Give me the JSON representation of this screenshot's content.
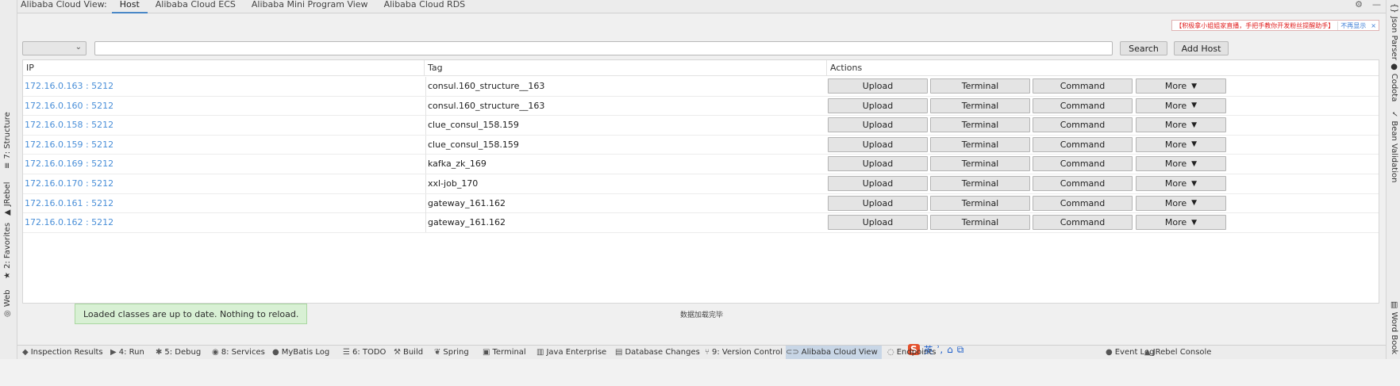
{
  "top_bar": {
    "tool_title": "Alibaba Cloud View:",
    "tabs": [
      {
        "label": "Host",
        "active": true
      },
      {
        "label": "Alibaba Cloud ECS",
        "active": false
      },
      {
        "label": "Alibaba Mini Program View",
        "active": false
      },
      {
        "label": "Alibaba Cloud RDS",
        "active": false
      }
    ],
    "gear_glyph": "⚙",
    "hide_glyph": "—"
  },
  "left_side_tabs": [
    {
      "label": "7: Structure",
      "glyph": "≡"
    },
    {
      "label": "JRebel",
      "glyph": "▲"
    },
    {
      "label": "2: Favorites",
      "glyph": "★"
    },
    {
      "label": "Web",
      "glyph": "◎"
    }
  ],
  "right_side_tabs": [
    {
      "label": "Json Parser",
      "glyph": "{}"
    },
    {
      "label": "Codota",
      "glyph": "●"
    },
    {
      "label": "Bean Validation",
      "glyph": "✓"
    },
    {
      "label": "Word Book",
      "glyph": "▤"
    }
  ],
  "banner": {
    "message": "【积极拿小姐姐家直播，手把手教你开发粉丝提醒助手】",
    "action": "不再显示",
    "close": "×"
  },
  "filter": {
    "select_value": "",
    "search_value": "",
    "search_button": "Search",
    "add_host_button": "Add Host"
  },
  "table": {
    "columns": [
      "IP",
      "Tag",
      "Actions"
    ],
    "rows": [
      {
        "ip": "172.16.0.163 : 5212",
        "tag": "consul.160_structure__163"
      },
      {
        "ip": "172.16.0.160 : 5212",
        "tag": "consul.160_structure__163"
      },
      {
        "ip": "172.16.0.158 : 5212",
        "tag": "clue_consul_158.159"
      },
      {
        "ip": "172.16.0.159 : 5212",
        "tag": "clue_consul_158.159"
      },
      {
        "ip": "172.16.0.169 : 5212",
        "tag": "kafka_zk_169"
      },
      {
        "ip": "172.16.0.170 : 5212",
        "tag": "xxl-job_170"
      },
      {
        "ip": "172.16.0.161 : 5212",
        "tag": "gateway_161.162"
      },
      {
        "ip": "172.16.0.162 : 5212",
        "tag": "gateway_161.162"
      }
    ],
    "actions": {
      "upload": "Upload",
      "terminal": "Terminal",
      "command": "Command",
      "more": "More",
      "more_glyph": "▼"
    }
  },
  "status_text": "数据加载完毕",
  "toast": "Loaded classes are up to date. Nothing to reload.",
  "bottom_tabs": [
    {
      "label": "Inspection Results",
      "glyph": "◆"
    },
    {
      "label": "4: Run",
      "glyph": "▶"
    },
    {
      "label": "5: Debug",
      "glyph": "✱"
    },
    {
      "label": "8: Services",
      "glyph": "◉"
    },
    {
      "label": "MyBatis Log",
      "glyph": "●"
    },
    {
      "label": "6: TODO",
      "glyph": "☰"
    },
    {
      "label": "Build",
      "glyph": "⚒"
    },
    {
      "label": "Spring",
      "glyph": "❦"
    },
    {
      "label": "Terminal",
      "glyph": "▣"
    },
    {
      "label": "Java Enterprise",
      "glyph": "▥"
    },
    {
      "label": "Database Changes",
      "glyph": "▤"
    },
    {
      "label": "9: Version Control",
      "glyph": "⑂"
    },
    {
      "label": "Alibaba Cloud View",
      "glyph": "⊂⊃",
      "active": true
    },
    {
      "label": "Endpoints",
      "glyph": "◌"
    },
    {
      "label": "Event Log",
      "glyph": "●"
    },
    {
      "label": "JRebel Console",
      "glyph": "▲"
    }
  ],
  "ime": {
    "logo": "S",
    "lang": "英",
    "punct": "ʾ,",
    "tool1": "⌂",
    "tool2": "⧉"
  },
  "colors": {
    "link": "#4a8fd8",
    "toast_bg": "#d8f0d4",
    "banner_text": "#e02020",
    "active_tab": "#c8d6e6"
  }
}
